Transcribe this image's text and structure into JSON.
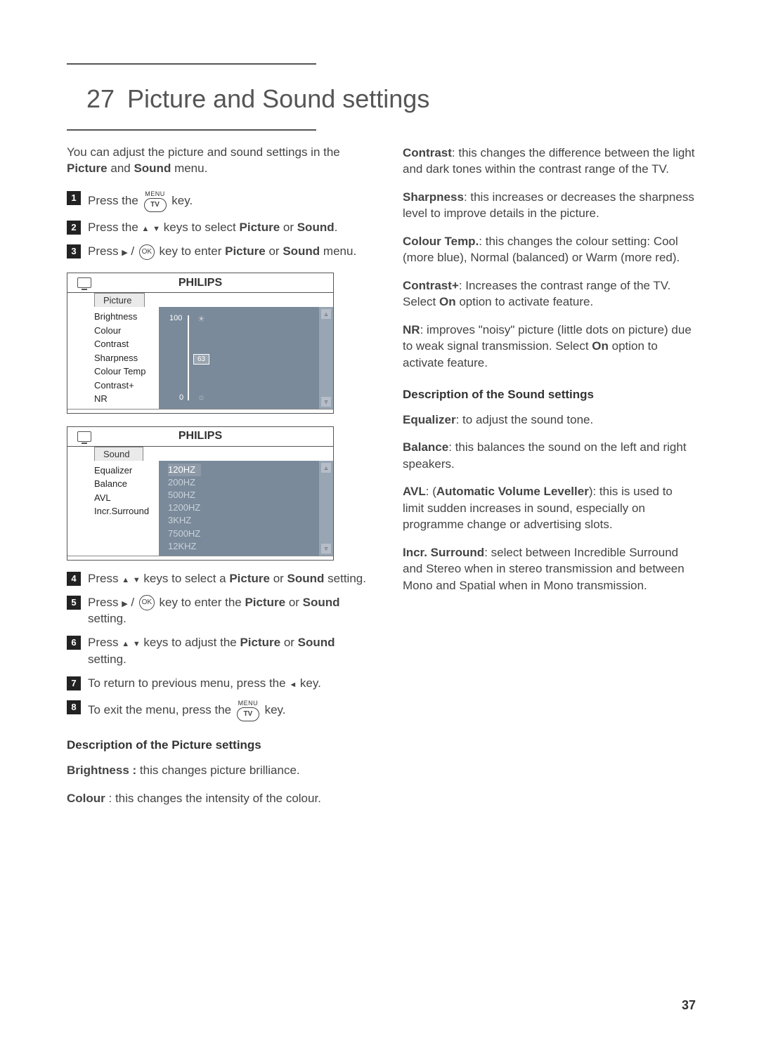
{
  "page_number": "37",
  "chapter_number": "27",
  "chapter_title": "Picture and Sound settings",
  "intro_prefix": "You can adjust the picture and sound settings in the ",
  "intro_b1": "Picture",
  "intro_mid": " and ",
  "intro_b2": "Sound",
  "intro_suffix": " menu.",
  "steps": {
    "s1_a": "Press the ",
    "s1_b": " key.",
    "s2_a": "Press the ",
    "s2_b": " keys to select ",
    "s2_c": "Picture",
    "s2_d": " or ",
    "s2_e": "Sound",
    "s2_f": ".",
    "s3_a": "Press ",
    "s3_b": " / ",
    "s3_c": " key to enter ",
    "s3_d": "Picture",
    "s3_e": " or ",
    "s3_f": "Sound",
    "s3_g": " menu.",
    "s4_a": "Press ",
    "s4_b": " keys to select a ",
    "s4_c": "Picture",
    "s4_d": " or ",
    "s4_e": "Sound",
    "s4_f": " setting.",
    "s5_a": "Press ",
    "s5_b": " / ",
    "s5_c": " key to enter the ",
    "s5_d": "Picture",
    "s5_e": " or ",
    "s5_f": "Sound",
    "s5_g": " setting.",
    "s6_a": "Press ",
    "s6_b": " keys to adjust the ",
    "s6_c": "Picture",
    "s6_d": " or ",
    "s6_e": "Sound",
    "s6_f": " setting.",
    "s7_a": "To return to previous menu, press the ",
    "s7_b": " key.",
    "s8_a": "To exit the menu, press the ",
    "s8_b": " key."
  },
  "icon": {
    "menu_label": "MENU",
    "tv_label": "TV",
    "ok_label": "OK"
  },
  "osd_picture": {
    "brand": "PHILIPS",
    "tab": "Picture",
    "items": [
      "Brightness",
      "Colour",
      "Contrast",
      "Sharpness",
      "Colour Temp",
      "Contrast+",
      "NR"
    ],
    "slider_max": "100",
    "slider_min": "0",
    "slider_value": "63"
  },
  "osd_sound": {
    "brand": "PHILIPS",
    "tab": "Sound",
    "items": [
      "Equalizer",
      "Balance",
      "AVL",
      "Incr.Surround"
    ],
    "freq": [
      "120HZ",
      "200HZ",
      "500HZ",
      "1200HZ",
      "3KHZ",
      "7500HZ",
      "12KHZ"
    ]
  },
  "pic_desc_heading": "Description of the Picture settings",
  "pic_desc": {
    "brightness_t": "Brightness : ",
    "brightness": "this changes picture brilliance.",
    "colour_t": "Colour",
    "colour": " : this changes the intensity of the colour.",
    "contrast_t": "Contrast",
    "contrast": ": this changes the difference between the light and dark tones within the contrast range of the TV.",
    "sharpness_t": "Sharpness",
    "sharpness": ": this increases or decreases the sharpness level to improve details in the picture.",
    "ctemp_t": "Colour Temp.",
    "ctemp": ": this changes the colour setting: Cool (more blue), Normal (balanced) or Warm (more red).",
    "cplus_t": "Contrast+",
    "cplus_a": ": Increases the contrast range of the TV. Select ",
    "cplus_on": "On",
    "cplus_b": " option to activate feature.",
    "nr_t": "NR",
    "nr_a": ": improves \"noisy\" picture (little dots on picture) due to weak signal transmission. Select ",
    "nr_on": "On",
    "nr_b": " option to activate feature."
  },
  "snd_desc_heading": "Description of the Sound settings",
  "snd_desc": {
    "eq_t": "Equalizer",
    "eq": ": to adjust the sound tone.",
    "bal_t": "Balance",
    "bal": ": this balances the sound on the left and right speakers.",
    "avl_t": "AVL",
    "avl_sub_a": ": (",
    "avl_sub_t": "Automatic  Volume Leveller",
    "avl_sub_b": "): this is used to limit sudden  increases in sound, especially on programme change or advertising slots.",
    "incr_t": "Incr. Surround",
    "incr": ": select between Incredible Surround  and Stereo when in stereo transmission and between Mono and Spatial when in Mono transmission."
  }
}
